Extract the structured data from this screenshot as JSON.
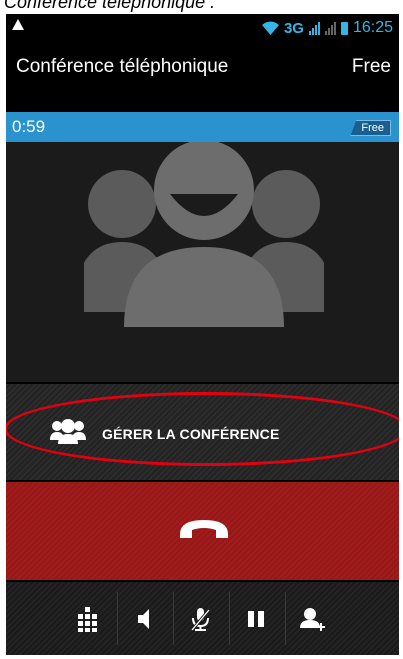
{
  "caption": "Conférence téléphonique :",
  "status_bar": {
    "network_type": "3G",
    "time": "16:25",
    "icons": [
      "warning-icon",
      "wifi-icon",
      "signal-icon",
      "battery-icon"
    ]
  },
  "header": {
    "title": "Conférence téléphonique",
    "operator": "Free"
  },
  "call": {
    "duration": "0:59",
    "badge": "Free"
  },
  "actions": {
    "manage_conference": "GÉRER LA CONFÉRENCE",
    "end_call_icon": "hangup-icon"
  },
  "controls": [
    "dialpad-icon",
    "speaker-icon",
    "mute-icon",
    "hold-icon",
    "add-call-icon"
  ],
  "colors": {
    "accent": "#33b5e5",
    "call_bar": "#2a93cf",
    "end_call": "#9b1a1a",
    "highlight": "#e3000f"
  }
}
